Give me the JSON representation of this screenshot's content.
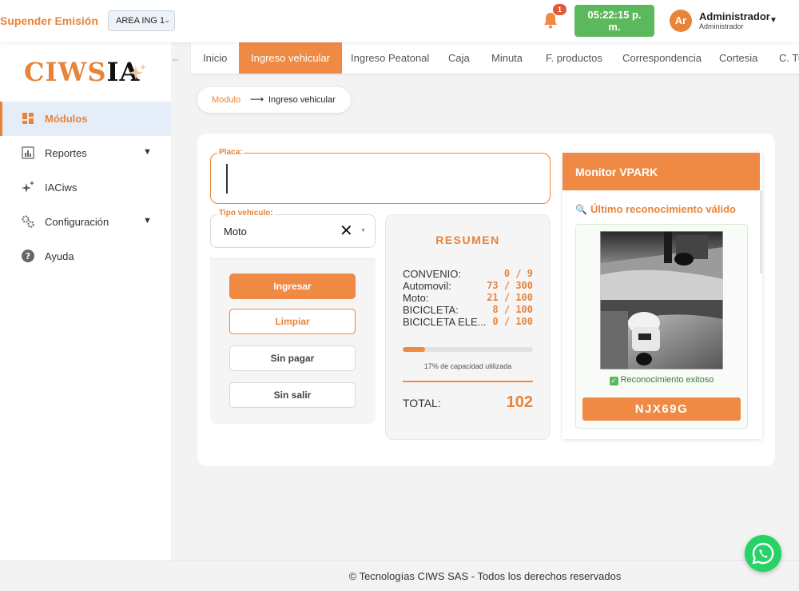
{
  "topbar": {
    "suspend_label": "Supender Emisión",
    "area_select_value": "AREA ING 1",
    "notifications_count": "1",
    "clock_line1": "05:22:15 p.",
    "clock_line2": "m.",
    "avatar_initials": "Ar",
    "user_name": "Administrador",
    "user_role": "Administrador"
  },
  "sidebar": {
    "logo_part1": "CIWS",
    "logo_part2": "IA",
    "items": [
      {
        "label": "Módulos",
        "icon": "grid-icon",
        "active": true
      },
      {
        "label": "Reportes",
        "icon": "bar-chart-icon",
        "has_caret": true
      },
      {
        "label": "IACiws",
        "icon": "sparkle-icon"
      },
      {
        "label": "Configuración",
        "icon": "gears-icon",
        "has_caret": true
      },
      {
        "label": "Ayuda",
        "icon": "help-icon"
      }
    ]
  },
  "tabs": [
    "Inicio",
    "Ingreso vehicular",
    "Ingreso Peatonal",
    "Caja",
    "Minuta",
    "F. productos",
    "Correspondencia",
    "Cortesia",
    "C. Tu"
  ],
  "active_tab": 1,
  "breadcrumb": {
    "module": "Modulo",
    "current": "Ingreso vehicular"
  },
  "form": {
    "placa_label": "Placa:",
    "placa_value": "",
    "tipo_label": "Tipo vehiculo:",
    "tipo_value": "Moto"
  },
  "buttons": {
    "ingresar": "Ingresar",
    "limpiar": "Limpiar",
    "sin_pagar": "Sin pagar",
    "sin_salir": "Sin salir"
  },
  "resumen": {
    "title": "RESUMEN",
    "rows": [
      {
        "label": "CONVENIO:",
        "value": "0 / 9"
      },
      {
        "label": "Automovil:",
        "value": "73 / 300"
      },
      {
        "label": "Moto:",
        "value": "21 / 100"
      },
      {
        "label": "BICICLETA:",
        "value": "8 / 100"
      },
      {
        "label": "BICICLETA ELE...",
        "value": "0 / 100"
      }
    ],
    "capacity_fraction": 0.17,
    "capacity_text": "17% de capacidad utilizada",
    "total_label": "TOTAL:",
    "total_value": "102"
  },
  "monitor": {
    "title": "Monitor VPARK",
    "last_label": "Último reconocimiento válido",
    "status": "Reconocimiento exitoso",
    "plate": "NJX69G"
  },
  "footer": {
    "text": "© Tecnologías CIWS SAS - Todos los derechos reservados"
  },
  "colors": {
    "accent": "#ef8a45",
    "success": "#5cb85c",
    "whatsapp": "#25d366"
  }
}
